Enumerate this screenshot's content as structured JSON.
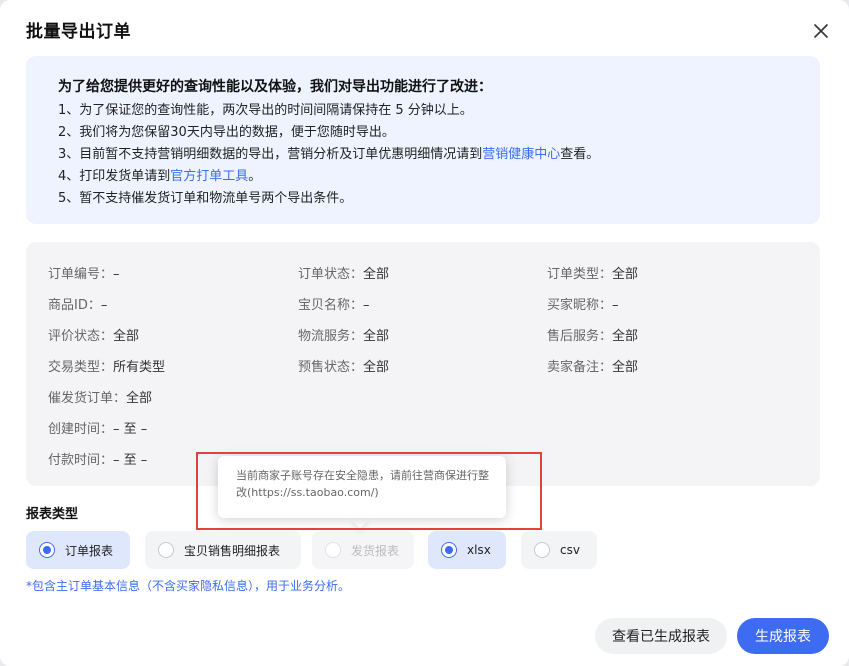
{
  "dialog": {
    "title": "批量导出订单"
  },
  "notice": {
    "heading": "为了给您提供更好的查询性能以及体验，我们对导出功能进行了改进：",
    "line1": "1、为了保证您的查询性能，两次导出的时间间隔请保持在 5 分钟以上。",
    "line2": "2、我们将为您保留30天内导出的数据，便于您随时导出。",
    "line3_pre": "3、目前暂不支持营销明细数据的导出，营销分析及订单优惠明细情况请到",
    "line3_link": "营销健康中心",
    "line3_post": "查看。",
    "line4_pre": "4、打印发货单请到",
    "line4_link": "官方打单工具",
    "line4_post": "。",
    "line5": "5、暂不支持催发货订单和物流单号两个导出条件。"
  },
  "filters": {
    "order_no_label": "订单编号：",
    "order_no_value": "–",
    "order_status_label": "订单状态：",
    "order_status_value": "全部",
    "order_type_label": "订单类型：",
    "order_type_value": "全部",
    "product_id_label": "商品ID：",
    "product_id_value": "–",
    "item_name_label": "宝贝名称：",
    "item_name_value": "–",
    "buyer_nick_label": "买家昵称：",
    "buyer_nick_value": "–",
    "review_status_label": "评价状态：",
    "review_status_value": "全部",
    "logistics_label": "物流服务：",
    "logistics_value": "全部",
    "aftersale_label": "售后服务：",
    "aftersale_value": "全部",
    "trade_type_label": "交易类型：",
    "trade_type_value": "所有类型",
    "presale_label": "预售状态：",
    "presale_value": "全部",
    "seller_note_label": "卖家备注：",
    "seller_note_value": "全部",
    "urge_label": "催发货订单：",
    "urge_value": "全部",
    "created_label": "创建时间：",
    "created_value": "– 至 –",
    "paid_label": "付款时间：",
    "paid_value": "– 至 –"
  },
  "tooltip": {
    "text": "当前商家子账号存在安全隐患，请前往营商保进行整改(https://ss.taobao.com/)"
  },
  "report": {
    "label": "报表类型",
    "options": [
      {
        "label": "订单报表",
        "selected": true
      },
      {
        "label": "宝贝销售明细报表",
        "selected": false
      },
      {
        "label": "发货报表",
        "disabled": true
      }
    ],
    "formats": [
      {
        "label": "xlsx",
        "selected": true
      },
      {
        "label": "csv",
        "selected": false
      }
    ],
    "hint": "*包含主订单基本信息（不含买家隐私信息），用于业务分析。"
  },
  "actions": {
    "view_generated": "查看已生成报表",
    "generate": "生成报表"
  },
  "colors": {
    "accent": "#3d6cf2",
    "highlight": "#e3423a"
  }
}
